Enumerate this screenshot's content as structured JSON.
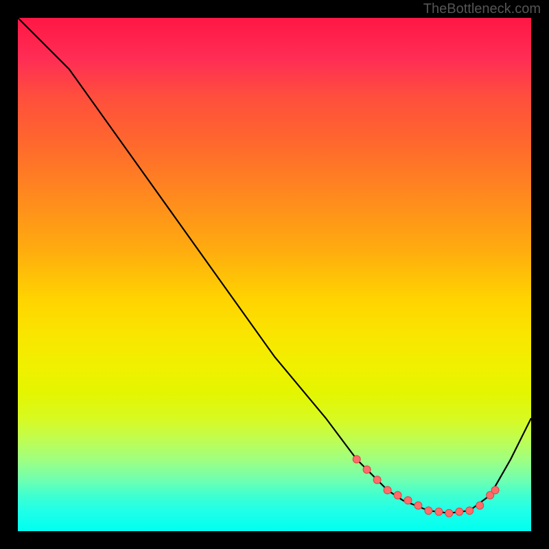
{
  "watermark": "TheBottleneck.com",
  "chart_data": {
    "type": "line",
    "title": "",
    "xlabel": "",
    "ylabel": "",
    "xlim": [
      0,
      100
    ],
    "ylim": [
      0,
      100
    ],
    "series": [
      {
        "name": "bottleneck-curve",
        "x": [
          0,
          4,
          10,
          20,
          30,
          40,
          50,
          60,
          66,
          72,
          75,
          80,
          84,
          88,
          92,
          96,
          100
        ],
        "values": [
          100,
          96,
          90,
          76,
          62,
          48,
          34,
          22,
          14,
          8,
          6,
          4,
          3.5,
          4,
          7,
          14,
          22
        ]
      }
    ],
    "dots": {
      "name": "highlight-points",
      "x": [
        66,
        68,
        70,
        72,
        74,
        76,
        78,
        80,
        82,
        84,
        86,
        88,
        90,
        92,
        93
      ],
      "values": [
        14,
        12,
        10,
        8,
        7,
        6,
        5,
        4,
        3.8,
        3.5,
        3.8,
        4,
        5,
        7,
        8
      ]
    }
  }
}
